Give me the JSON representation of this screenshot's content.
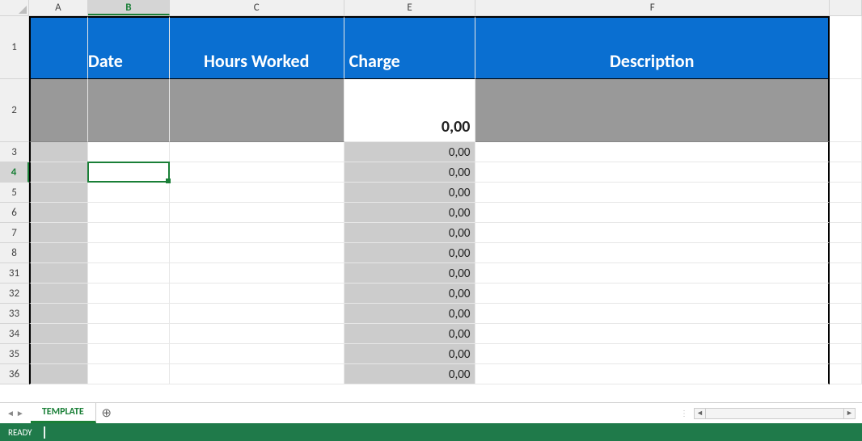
{
  "columns": {
    "A": "A",
    "B": "B",
    "C": "C",
    "E": "E",
    "F": "F"
  },
  "selectedColumn": "B",
  "selectedRow": "4",
  "headerRow": {
    "date": "Date",
    "hours": "Hours Worked",
    "charge": "Charge",
    "description": "Description"
  },
  "totalRowCharge": "0,00",
  "rows": [
    {
      "num": "3",
      "charge": "0,00"
    },
    {
      "num": "4",
      "charge": "0,00"
    },
    {
      "num": "5",
      "charge": "0,00"
    },
    {
      "num": "6",
      "charge": "0,00"
    },
    {
      "num": "7",
      "charge": "0,00"
    },
    {
      "num": "8",
      "charge": "0,00"
    },
    {
      "num": "31",
      "charge": "0,00"
    },
    {
      "num": "32",
      "charge": "0,00"
    },
    {
      "num": "33",
      "charge": "0,00"
    },
    {
      "num": "34",
      "charge": "0,00"
    },
    {
      "num": "35",
      "charge": "0,00"
    },
    {
      "num": "36",
      "charge": "0,00"
    }
  ],
  "row1Label": "1",
  "row2Label": "2",
  "sheetTab": "TEMPLATE",
  "statusText": "READY"
}
